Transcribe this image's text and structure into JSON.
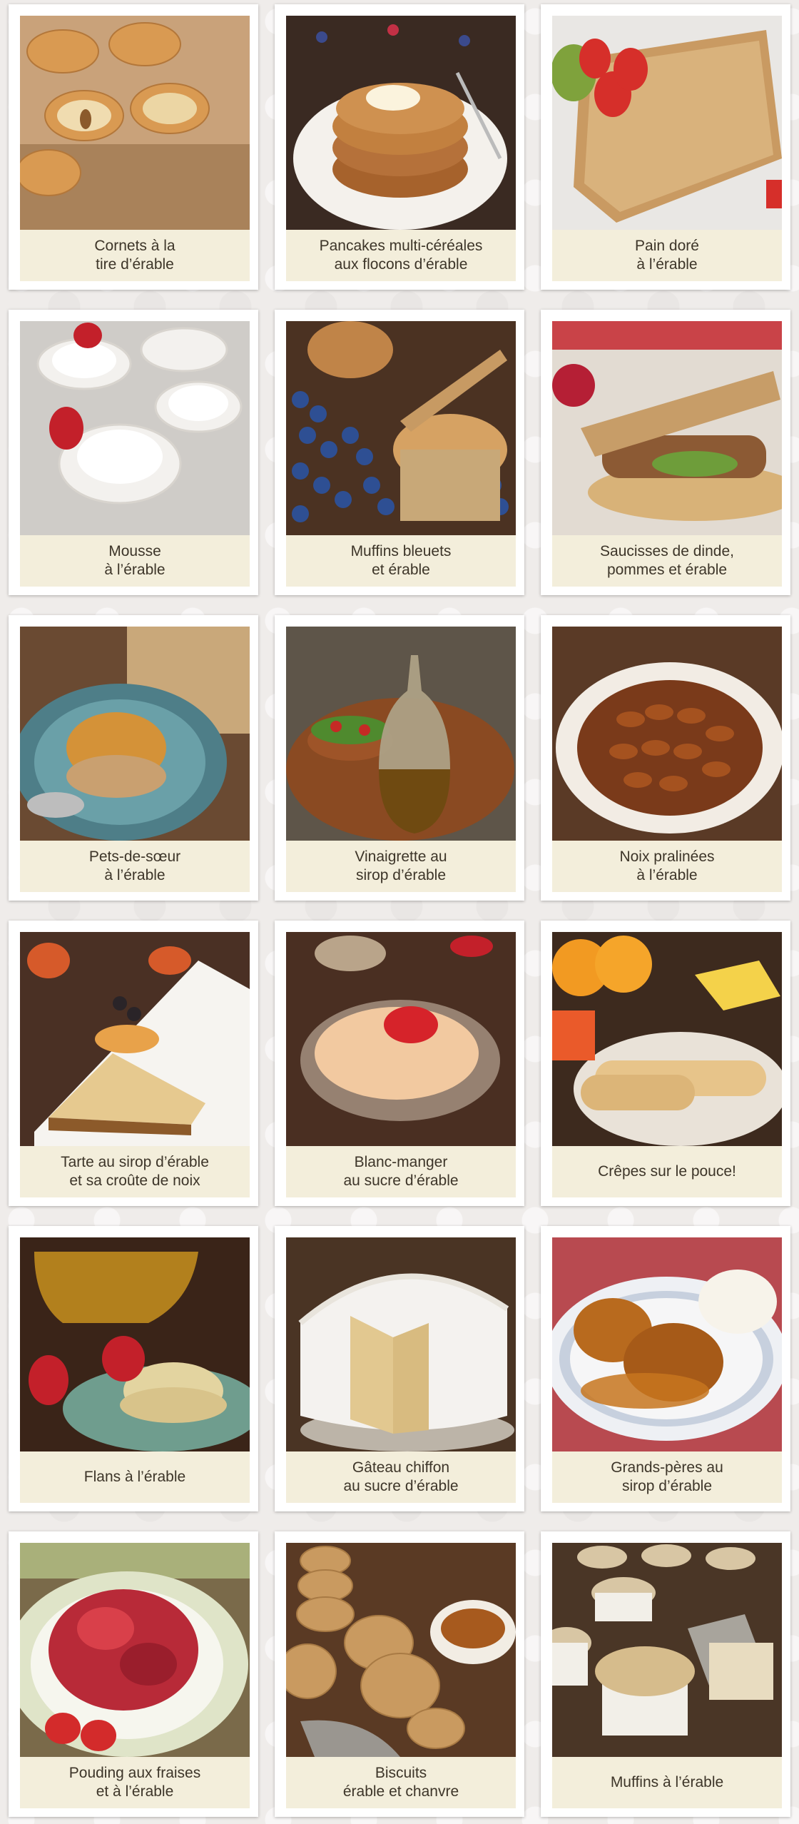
{
  "recipes": [
    {
      "line1": "Cornets à la",
      "line2": "tire d’érable",
      "image": "waffle-cones-photo"
    },
    {
      "line1": "Pancakes multi-céréales",
      "line2": "aux flocons d’érable",
      "image": "pancakes-photo"
    },
    {
      "line1": "Pain doré",
      "line2": "à l’érable",
      "image": "french-toast-photo"
    },
    {
      "line1": "Mousse",
      "line2": "à l’érable",
      "image": "mousse-photo"
    },
    {
      "line1": "Muffins bleuets",
      "line2": "et érable",
      "image": "blueberry-muffins-photo"
    },
    {
      "line1": "Saucisses de dinde,",
      "line2": "pommes et érable",
      "image": "sausage-sandwich-photo"
    },
    {
      "line1": "Pets-de-sœur",
      "line2": "à l’érable",
      "image": "pets-de-soeur-photo"
    },
    {
      "line1": "Vinaigrette au",
      "line2": "sirop d’érable",
      "image": "vinaigrette-photo"
    },
    {
      "line1": "Noix pralinées",
      "line2": "à l’érable",
      "image": "praline-nuts-photo"
    },
    {
      "line1": "Tarte au sirop d’érable",
      "line2": "et sa croûte de noix",
      "image": "maple-tart-photo"
    },
    {
      "line1": "Blanc-manger",
      "line2": "au sucre d’érable",
      "image": "blanc-manger-photo"
    },
    {
      "line1": "Crêpes sur le pouce!",
      "line2": "",
      "image": "crepes-photo"
    },
    {
      "line1": "Flans à l’érable",
      "line2": "",
      "image": "flans-photo"
    },
    {
      "line1": "Gâteau chiffon",
      "line2": "au sucre d’érable",
      "image": "chiffon-cake-photo"
    },
    {
      "line1": "Grands-pères au",
      "line2": "sirop d’érable",
      "image": "grands-peres-photo"
    },
    {
      "line1": "Pouding aux fraises",
      "line2": "et à l’érable",
      "image": "strawberry-pudding-photo"
    },
    {
      "line1": "Biscuits",
      "line2": "érable et chanvre",
      "image": "hemp-cookies-photo"
    },
    {
      "line1": "Muffins à l’érable",
      "line2": "",
      "image": "maple-muffins-photo"
    }
  ]
}
